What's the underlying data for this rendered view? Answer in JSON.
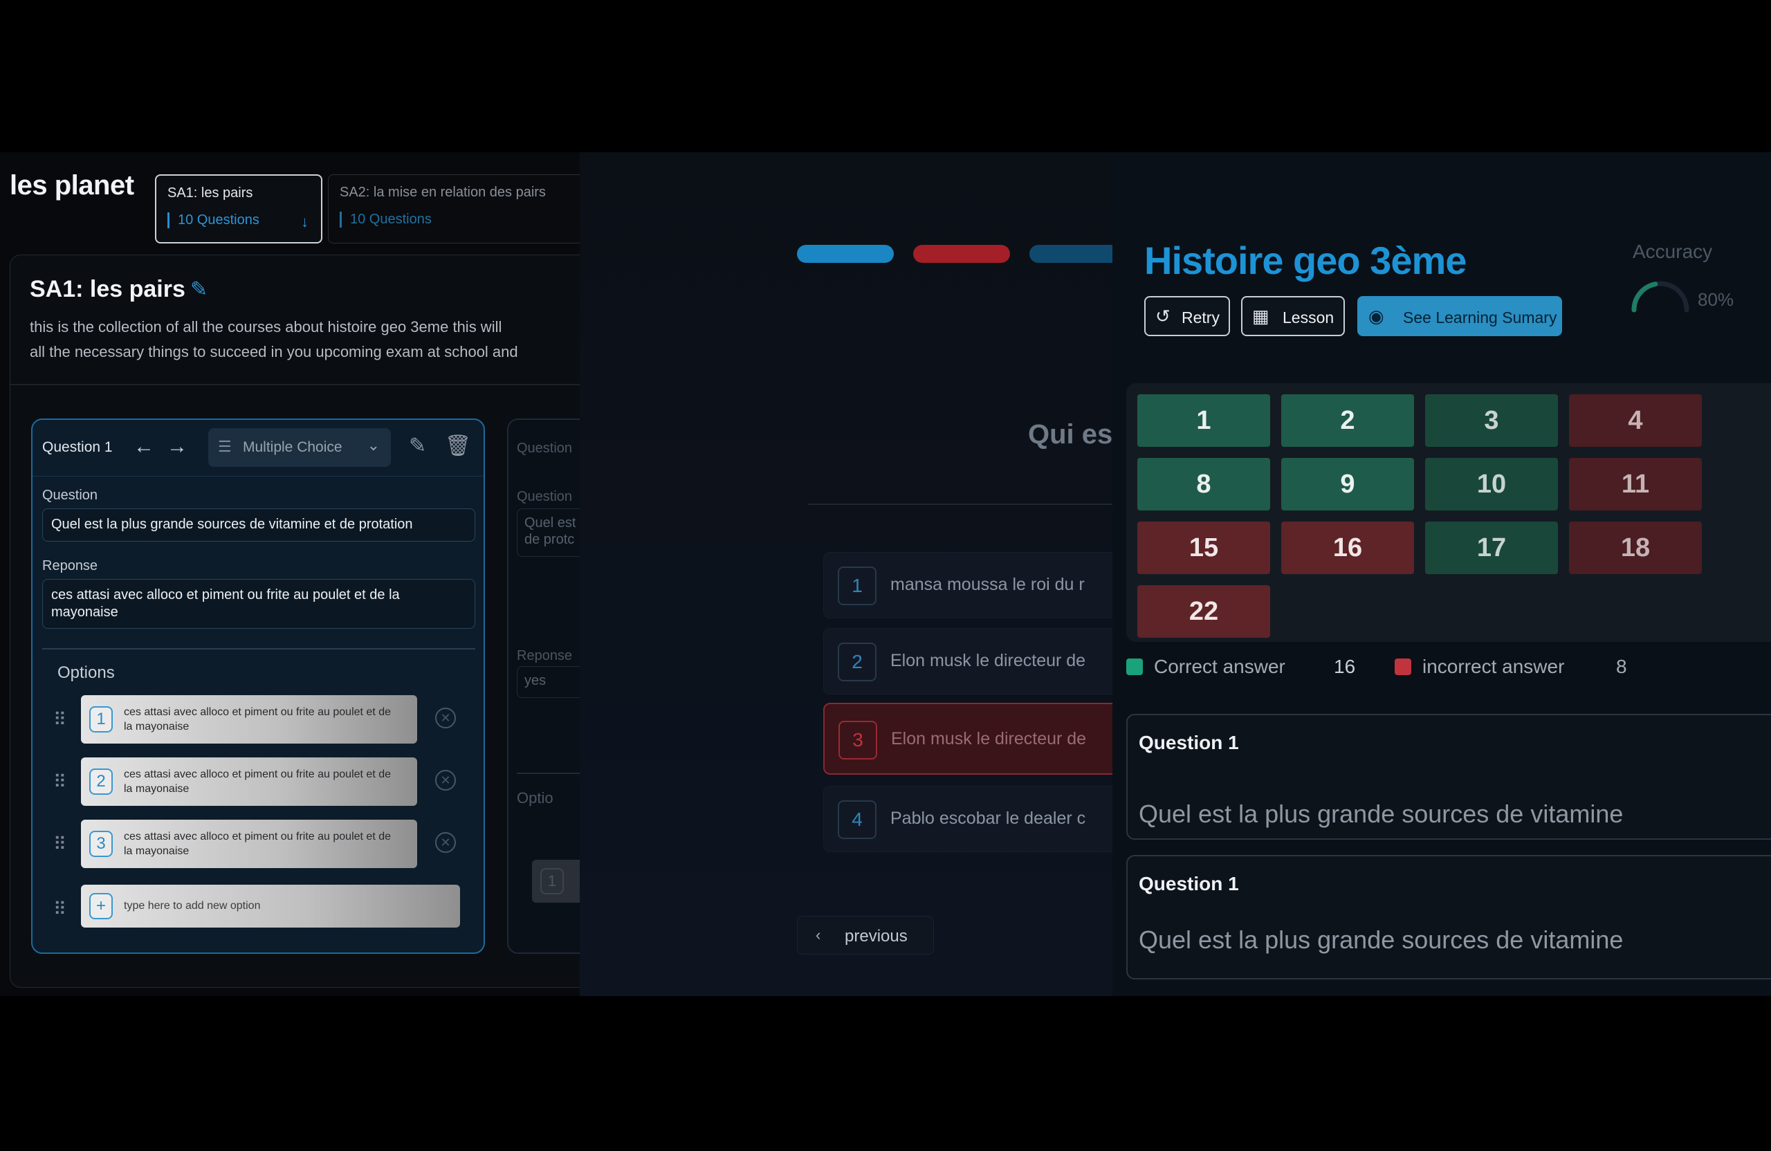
{
  "editor": {
    "course_title": "les planet",
    "tabs": [
      {
        "title": "SA1: les pairs",
        "subtitle": "10 Questions"
      },
      {
        "title": "SA2: la mise en relation des pairs",
        "subtitle": "10 Questions"
      }
    ],
    "sa_heading": "SA1: les pairs",
    "sa_description_line1": "this is the collection of all the courses about histoire geo 3eme this will",
    "sa_description_line2": "all the necessary things to succeed in you upcoming exam at school and",
    "question_card": {
      "name": "Question 1",
      "type": "Multiple Choice",
      "question_label": "Question",
      "question_value": "Quel est la plus grande sources de vitamine et de protation",
      "response_label": "Reponse",
      "response_value": "ces attasi avec alloco et piment  ou frite au poulet et de la mayonaise",
      "options_title": "Options",
      "options": [
        {
          "num": "1",
          "text": "ces attasi avec alloco et piment  ou frite au poulet et de la mayonaise"
        },
        {
          "num": "2",
          "text": "ces attasi avec alloco et piment  ou frite au poulet et de la mayonaise"
        },
        {
          "num": "3",
          "text": "ces attasi avec alloco et piment  ou frite au poulet et de la mayonaise"
        }
      ],
      "add_option_placeholder": "type here to add new option",
      "add_symbol": "+"
    },
    "question_card_2": {
      "name": "Question",
      "question_label": "Question",
      "question_value_line1": "Quel est",
      "question_value_line2": "de protc",
      "response_label": "Reponse",
      "response_value": "yes",
      "options_title": "Optio",
      "option_num": "1"
    }
  },
  "quiz": {
    "progress_colors": [
      "#1a86c4",
      "#a51f28",
      "#0f4a6e"
    ],
    "question_partial": "Qui es",
    "answers": [
      {
        "num": "1",
        "text": "mansa moussa le roi du r",
        "state": "normal"
      },
      {
        "num": "2",
        "text": "Elon musk le directeur de",
        "state": "normal"
      },
      {
        "num": "3",
        "text": "Elon musk le directeur de",
        "state": "wrong"
      },
      {
        "num": "4",
        "text": "Pablo escobar le dealer c",
        "state": "normal"
      }
    ],
    "previous_label": "previous"
  },
  "results": {
    "title": "Histoire geo 3ème",
    "accuracy_label": "Accuracy",
    "accuracy_value": "80%",
    "accuracy_fraction": 0.8,
    "buttons": {
      "retry": "Retry",
      "lesson": "Lesson",
      "summary": "See Learning Sumary"
    },
    "grid_cells": [
      {
        "n": "1",
        "status": "correct"
      },
      {
        "n": "2",
        "status": "correct"
      },
      {
        "n": "3",
        "status": "correct"
      },
      {
        "n": "4",
        "status": "incorrect"
      },
      {
        "n": "8",
        "status": "correct"
      },
      {
        "n": "9",
        "status": "correct"
      },
      {
        "n": "10",
        "status": "correct"
      },
      {
        "n": "11",
        "status": "incorrect"
      },
      {
        "n": "15",
        "status": "incorrect"
      },
      {
        "n": "16",
        "status": "incorrect"
      },
      {
        "n": "17",
        "status": "correct"
      },
      {
        "n": "18",
        "status": "incorrect"
      },
      {
        "n": "22",
        "status": "incorrect"
      }
    ],
    "legend": {
      "correct_label": "Correct answer",
      "correct_count": "16",
      "correct_color": "#1aa37a",
      "incorrect_label": "incorrect answer",
      "incorrect_count": "8",
      "incorrect_color": "#c2343d"
    },
    "questions": [
      {
        "name": "Question 1",
        "text": "Quel est la plus grande sources de vitamine"
      },
      {
        "name": "Question 1",
        "text": "Quel est la plus grande sources de vitamine"
      }
    ]
  }
}
